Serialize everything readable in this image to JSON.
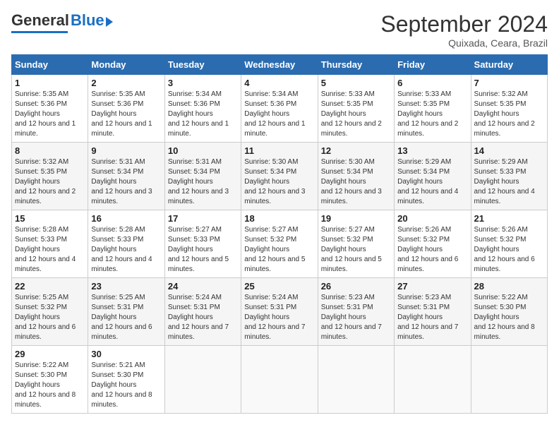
{
  "logo": {
    "general": "General",
    "blue": "Blue"
  },
  "title": "September 2024",
  "subtitle": "Quixada, Ceara, Brazil",
  "days_of_week": [
    "Sunday",
    "Monday",
    "Tuesday",
    "Wednesday",
    "Thursday",
    "Friday",
    "Saturday"
  ],
  "weeks": [
    [
      {
        "day": "1",
        "sunrise": "5:35 AM",
        "sunset": "5:36 PM",
        "daylight": "12 hours and 1 minute."
      },
      {
        "day": "2",
        "sunrise": "5:35 AM",
        "sunset": "5:36 PM",
        "daylight": "12 hours and 1 minute."
      },
      {
        "day": "3",
        "sunrise": "5:34 AM",
        "sunset": "5:36 PM",
        "daylight": "12 hours and 1 minute."
      },
      {
        "day": "4",
        "sunrise": "5:34 AM",
        "sunset": "5:36 PM",
        "daylight": "12 hours and 1 minute."
      },
      {
        "day": "5",
        "sunrise": "5:33 AM",
        "sunset": "5:35 PM",
        "daylight": "12 hours and 2 minutes."
      },
      {
        "day": "6",
        "sunrise": "5:33 AM",
        "sunset": "5:35 PM",
        "daylight": "12 hours and 2 minutes."
      },
      {
        "day": "7",
        "sunrise": "5:32 AM",
        "sunset": "5:35 PM",
        "daylight": "12 hours and 2 minutes."
      }
    ],
    [
      {
        "day": "8",
        "sunrise": "5:32 AM",
        "sunset": "5:35 PM",
        "daylight": "12 hours and 2 minutes."
      },
      {
        "day": "9",
        "sunrise": "5:31 AM",
        "sunset": "5:34 PM",
        "daylight": "12 hours and 3 minutes."
      },
      {
        "day": "10",
        "sunrise": "5:31 AM",
        "sunset": "5:34 PM",
        "daylight": "12 hours and 3 minutes."
      },
      {
        "day": "11",
        "sunrise": "5:30 AM",
        "sunset": "5:34 PM",
        "daylight": "12 hours and 3 minutes."
      },
      {
        "day": "12",
        "sunrise": "5:30 AM",
        "sunset": "5:34 PM",
        "daylight": "12 hours and 3 minutes."
      },
      {
        "day": "13",
        "sunrise": "5:29 AM",
        "sunset": "5:34 PM",
        "daylight": "12 hours and 4 minutes."
      },
      {
        "day": "14",
        "sunrise": "5:29 AM",
        "sunset": "5:33 PM",
        "daylight": "12 hours and 4 minutes."
      }
    ],
    [
      {
        "day": "15",
        "sunrise": "5:28 AM",
        "sunset": "5:33 PM",
        "daylight": "12 hours and 4 minutes."
      },
      {
        "day": "16",
        "sunrise": "5:28 AM",
        "sunset": "5:33 PM",
        "daylight": "12 hours and 4 minutes."
      },
      {
        "day": "17",
        "sunrise": "5:27 AM",
        "sunset": "5:33 PM",
        "daylight": "12 hours and 5 minutes."
      },
      {
        "day": "18",
        "sunrise": "5:27 AM",
        "sunset": "5:32 PM",
        "daylight": "12 hours and 5 minutes."
      },
      {
        "day": "19",
        "sunrise": "5:27 AM",
        "sunset": "5:32 PM",
        "daylight": "12 hours and 5 minutes."
      },
      {
        "day": "20",
        "sunrise": "5:26 AM",
        "sunset": "5:32 PM",
        "daylight": "12 hours and 6 minutes."
      },
      {
        "day": "21",
        "sunrise": "5:26 AM",
        "sunset": "5:32 PM",
        "daylight": "12 hours and 6 minutes."
      }
    ],
    [
      {
        "day": "22",
        "sunrise": "5:25 AM",
        "sunset": "5:32 PM",
        "daylight": "12 hours and 6 minutes."
      },
      {
        "day": "23",
        "sunrise": "5:25 AM",
        "sunset": "5:31 PM",
        "daylight": "12 hours and 6 minutes."
      },
      {
        "day": "24",
        "sunrise": "5:24 AM",
        "sunset": "5:31 PM",
        "daylight": "12 hours and 7 minutes."
      },
      {
        "day": "25",
        "sunrise": "5:24 AM",
        "sunset": "5:31 PM",
        "daylight": "12 hours and 7 minutes."
      },
      {
        "day": "26",
        "sunrise": "5:23 AM",
        "sunset": "5:31 PM",
        "daylight": "12 hours and 7 minutes."
      },
      {
        "day": "27",
        "sunrise": "5:23 AM",
        "sunset": "5:31 PM",
        "daylight": "12 hours and 7 minutes."
      },
      {
        "day": "28",
        "sunrise": "5:22 AM",
        "sunset": "5:30 PM",
        "daylight": "12 hours and 8 minutes."
      }
    ],
    [
      {
        "day": "29",
        "sunrise": "5:22 AM",
        "sunset": "5:30 PM",
        "daylight": "12 hours and 8 minutes."
      },
      {
        "day": "30",
        "sunrise": "5:21 AM",
        "sunset": "5:30 PM",
        "daylight": "12 hours and 8 minutes."
      },
      null,
      null,
      null,
      null,
      null
    ]
  ]
}
